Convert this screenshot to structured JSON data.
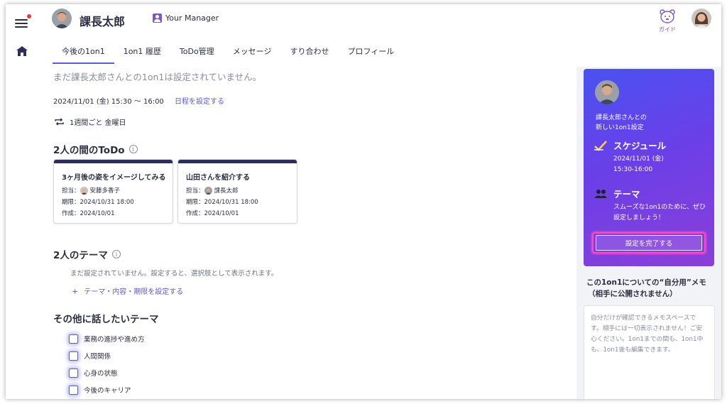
{
  "header": {
    "user_name": "課長太郎",
    "manager_badge": "Your Manager",
    "guide_label": "ガイド",
    "colors": {
      "accent": "#5b5bd6",
      "manager_badge": "#7e57c2",
      "notification_dot": "#e53935"
    },
    "icons": [
      "hamburger-menu-icon",
      "notification-dot-icon",
      "home-icon",
      "user-badge-icon",
      "guide-bear-icon"
    ]
  },
  "tabs": [
    {
      "label": "今後の1on1",
      "active": true
    },
    {
      "label": "1on1 履歴",
      "active": false
    },
    {
      "label": "ToDo管理",
      "active": false
    },
    {
      "label": "メッセージ",
      "active": false
    },
    {
      "label": "すり合わせ",
      "active": false
    },
    {
      "label": "プロフィール",
      "active": false
    }
  ],
  "main": {
    "notice": "まだ課長太郎さんとの1on1は設定されていません。",
    "datetime": "2024/11/01 (金) 15:30 〜 16:00",
    "schedule_link": "日程を設定する",
    "recurrence": "1週間ごと 金曜日",
    "todo_section": {
      "title": "2人の間のToDo",
      "cards": [
        {
          "title": "3ヶ月後の姿をイメージしてみる",
          "assignee_label": "担当：",
          "assignee": "安藤多香子",
          "due": "期限：2024/10/31 18:00",
          "created": "作成：2024/10/01"
        },
        {
          "title": "山田さんを紹介する",
          "assignee_label": "担当：",
          "assignee": "課長太郎",
          "due": "期限：2024/10/31 18:00",
          "created": "作成：2024/10/01"
        }
      ]
    },
    "theme_section": {
      "title": "2人のテーマ",
      "empty": "まだ設定されていません。設定すると、選択肢として表示されます。",
      "add_link": "テーマ・内容・期限を設定する"
    },
    "other_section": {
      "title": "その他に話したいテーマ",
      "items": [
        "業務の進捗や進め方",
        "人間関係",
        "心身の状態",
        "今後のキャリア"
      ]
    }
  },
  "setup_card": {
    "intro_line1": "課長太郎さんとの",
    "intro_line2": "新しい1on1設定",
    "schedule_title": "スケジュール",
    "schedule_date": "2024/11/01 (金)",
    "schedule_time": "15:30-16:00",
    "theme_title": "テーマ",
    "theme_text": "スムーズな1on1のために、ぜひ設定しましょう！",
    "complete_button": "設定を完了する",
    "colors": {
      "gradient_start": "#4a52f0",
      "gradient_end": "#8b3fd8",
      "button_highlight": "#ff49c8"
    }
  },
  "memo": {
    "title_line1": "この1on1についての“自分用”メモ",
    "title_line2": "（相手に公開されません）",
    "placeholder": "自分だけが確認できるメモスペースです。相手には一切表示されません！ご安心ください。1on1までの間も、1on1中も、1on1後も編集できます。"
  }
}
